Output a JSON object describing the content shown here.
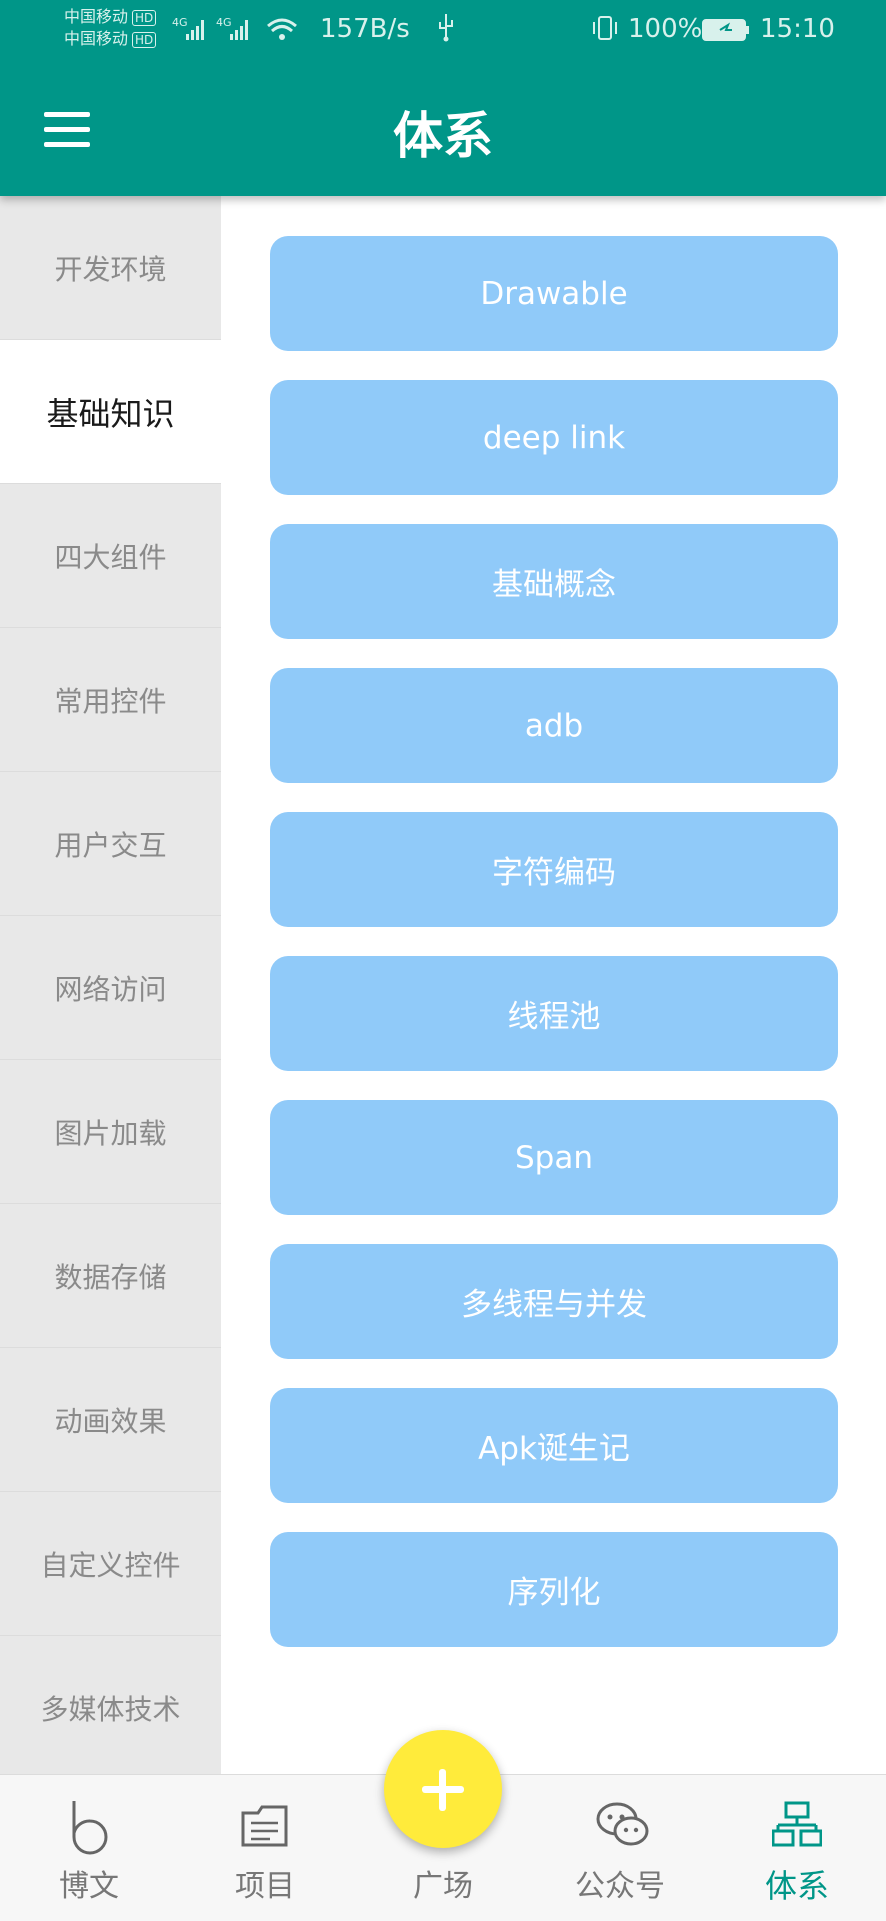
{
  "status_bar": {
    "carrier_1": "中国移动",
    "carrier_2": "中国移动",
    "hd_badge": "HD",
    "net_type": "4G",
    "net_speed": "157B/s",
    "battery": "100%",
    "time": "15:10"
  },
  "header": {
    "title": "体系",
    "menu_icon": "hamburger-menu-icon"
  },
  "sidebar": {
    "items": [
      {
        "label": "开发环境"
      },
      {
        "label": "基础知识",
        "active": true
      },
      {
        "label": "四大组件"
      },
      {
        "label": "常用控件"
      },
      {
        "label": "用户交互"
      },
      {
        "label": "网络访问"
      },
      {
        "label": "图片加载"
      },
      {
        "label": "数据存储"
      },
      {
        "label": "动画效果"
      },
      {
        "label": "自定义控件"
      },
      {
        "label": "多媒体技术"
      }
    ]
  },
  "content": {
    "tags": [
      {
        "label": "Drawable"
      },
      {
        "label": "deep link"
      },
      {
        "label": "基础概念"
      },
      {
        "label": "adb"
      },
      {
        "label": "字符编码"
      },
      {
        "label": "线程池"
      },
      {
        "label": "Span"
      },
      {
        "label": "多线程与并发"
      },
      {
        "label": "Apk诞生记"
      },
      {
        "label": "序列化"
      }
    ]
  },
  "bottom_nav": {
    "items": [
      {
        "label": "博文",
        "icon": "blog-b-icon"
      },
      {
        "label": "项目",
        "icon": "folder-icon"
      },
      {
        "label": "广场",
        "icon": "plus-icon"
      },
      {
        "label": "公众号",
        "icon": "wechat-icon"
      },
      {
        "label": "体系",
        "icon": "hierarchy-icon",
        "active": true
      }
    ]
  },
  "colors": {
    "primary": "#009688",
    "tag_bg": "#90caf9",
    "fab": "#ffeb3b",
    "sidebar_bg": "#e8e8e8"
  }
}
